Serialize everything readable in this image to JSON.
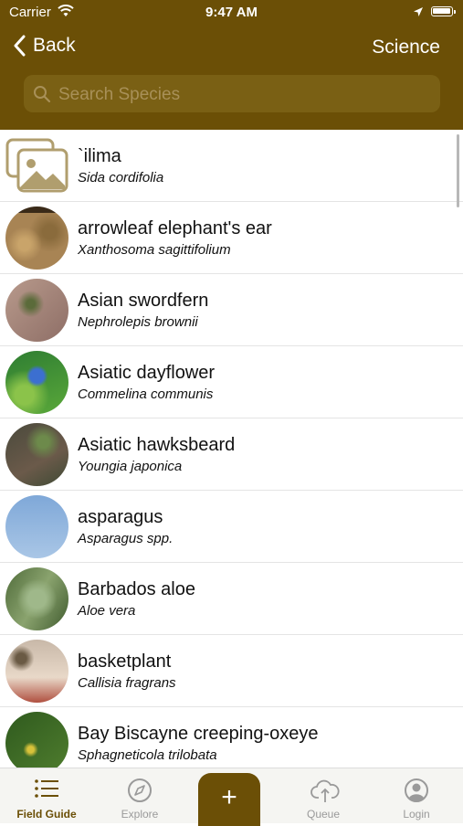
{
  "status_bar": {
    "carrier": "Carrier",
    "time": "9:47 AM"
  },
  "nav": {
    "back_label": "Back",
    "right_label": "Science"
  },
  "search": {
    "placeholder": "Search Species"
  },
  "species": [
    {
      "name": "`ilima",
      "scientific": "Sida cordifolia",
      "thumb": "placeholder-image-icon"
    },
    {
      "name": "arrowleaf elephant's ear",
      "scientific": "Xanthosoma sagittifolium",
      "thumb": "photo"
    },
    {
      "name": "Asian swordfern",
      "scientific": "Nephrolepis brownii",
      "thumb": "photo"
    },
    {
      "name": "Asiatic dayflower",
      "scientific": "Commelina communis",
      "thumb": "photo"
    },
    {
      "name": "Asiatic hawksbeard",
      "scientific": "Youngia japonica",
      "thumb": "photo"
    },
    {
      "name": "asparagus",
      "scientific": "Asparagus spp.",
      "thumb": "photo"
    },
    {
      "name": "Barbados aloe",
      "scientific": "Aloe vera",
      "thumb": "photo"
    },
    {
      "name": "basketplant",
      "scientific": "Callisia fragrans",
      "thumb": "photo"
    },
    {
      "name": "Bay Biscayne creeping-oxeye",
      "scientific": "Sphagneticola trilobata",
      "thumb": "photo"
    }
  ],
  "tabs": [
    {
      "label": "Field Guide",
      "icon": "list-icon",
      "active": true
    },
    {
      "label": "Explore",
      "icon": "compass-icon",
      "active": false
    },
    {
      "label": "Queue",
      "icon": "cloud-upload-icon",
      "active": false
    },
    {
      "label": "Login",
      "icon": "person-circle-icon",
      "active": false
    }
  ],
  "fab": {
    "label": "+"
  },
  "colors": {
    "header": "#6b4f06",
    "accent": "#6b4f06",
    "tab_inactive": "#9a9a9a"
  }
}
